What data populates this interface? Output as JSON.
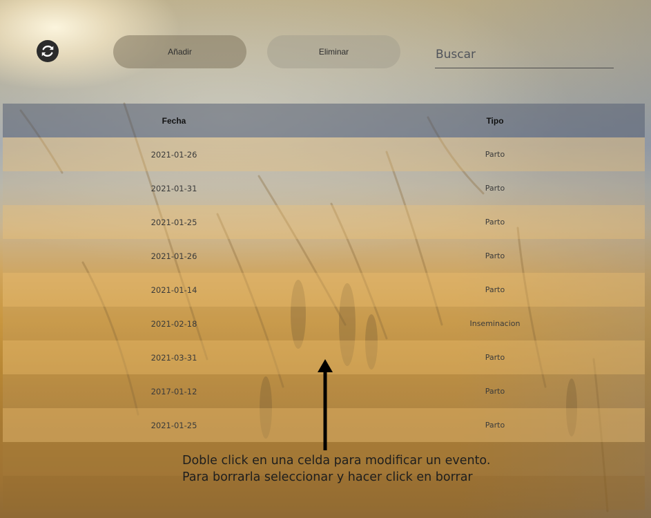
{
  "toolbar": {
    "add_label": "Añadir",
    "delete_label": "Eliminar",
    "search_placeholder": "Buscar",
    "refresh_icon": "refresh-icon"
  },
  "table": {
    "columns": [
      "Fecha",
      "Tipo"
    ],
    "rows": [
      {
        "fecha": "2021-01-26",
        "tipo": "Parto"
      },
      {
        "fecha": "2021-01-31",
        "tipo": "Parto"
      },
      {
        "fecha": "2021-01-25",
        "tipo": "Parto"
      },
      {
        "fecha": "2021-01-26",
        "tipo": "Parto"
      },
      {
        "fecha": "2021-01-14",
        "tipo": "Parto"
      },
      {
        "fecha": "2021-02-18",
        "tipo": "Inseminacion"
      },
      {
        "fecha": "2021-03-31",
        "tipo": "Parto"
      },
      {
        "fecha": "2017-01-12",
        "tipo": "Parto"
      },
      {
        "fecha": "2021-01-25",
        "tipo": "Parto"
      }
    ]
  },
  "hint": {
    "line1": "Doble click en una celda para modificar un evento.",
    "line2": "Para borrarla seleccionar y hacer click en borrar"
  },
  "colors": {
    "header_bg": "#55607380",
    "text": "#3a3a3a",
    "arrow": "#000000"
  }
}
